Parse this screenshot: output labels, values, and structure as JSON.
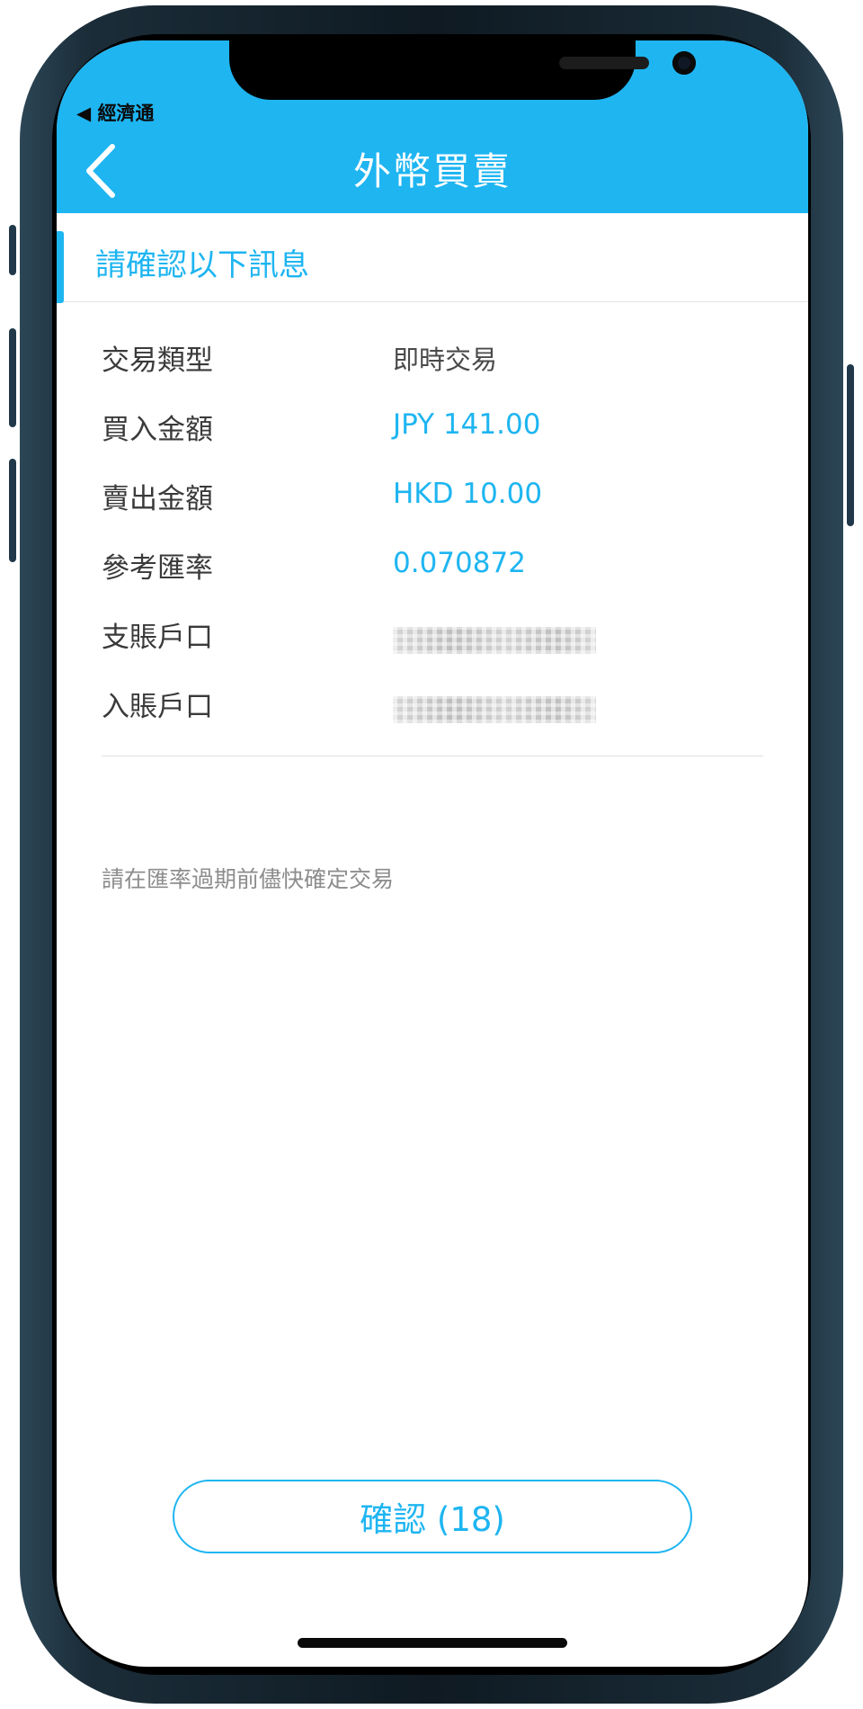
{
  "status_bar": {
    "back_app_label": "◀ 經濟通"
  },
  "header": {
    "title": "外幣買賣",
    "back_icon": "chevron-left-icon"
  },
  "section": {
    "title": "請確認以下訊息"
  },
  "details": {
    "transaction_type": {
      "label": "交易類型",
      "value": "即時交易"
    },
    "buy_amount": {
      "label": "買入金額",
      "value": "JPY 141.00"
    },
    "sell_amount": {
      "label": "賣出金額",
      "value": "HKD 10.00"
    },
    "reference_rate": {
      "label": "參考匯率",
      "value": "0.070872"
    },
    "debit_account": {
      "label": "支賬戶口"
    },
    "credit_account": {
      "label": "入賬戶口"
    }
  },
  "notice": "請在匯率過期前儘快確定交易",
  "confirm_button": {
    "label": "確認 (18)"
  },
  "colors": {
    "accent": "#1eb5f1",
    "label_text": "#3a3a3a",
    "notice_text": "#8d8d8d"
  }
}
